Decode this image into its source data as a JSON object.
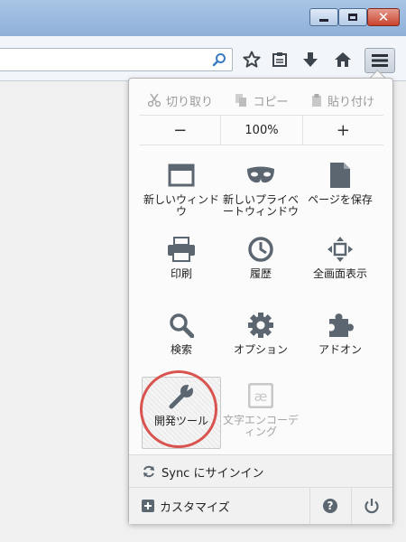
{
  "colors": {
    "titlebar": "#9fbde2",
    "panel_bg": "#fbfbfb",
    "icon_gray": "#5c6670",
    "highlight_circle": "#d9534f"
  },
  "window_controls": {
    "minimize_icon": "minimize-icon",
    "maximize_icon": "maximize-icon",
    "close_icon": "close-icon",
    "close_glyph": "✕"
  },
  "toolbar": {
    "icons": [
      "search-icon",
      "bookmark-star-icon",
      "reading-list-icon",
      "download-icon",
      "home-icon",
      "hamburger-menu-icon"
    ]
  },
  "menu": {
    "edit": {
      "cut": "切り取り",
      "copy": "コピー",
      "paste": "貼り付け"
    },
    "zoom": {
      "minus": "−",
      "level": "100%",
      "plus": "+"
    },
    "items": [
      {
        "label": "新しいウィンドウ",
        "icon": "new-window-icon",
        "enabled": true
      },
      {
        "label": "新しいプライベートウィンドウ",
        "icon": "private-window-icon",
        "enabled": true
      },
      {
        "label": "ページを保存",
        "icon": "save-page-icon",
        "enabled": true
      },
      {
        "label": "印刷",
        "icon": "print-icon",
        "enabled": true
      },
      {
        "label": "履歴",
        "icon": "history-icon",
        "enabled": true
      },
      {
        "label": "全画面表示",
        "icon": "fullscreen-icon",
        "enabled": true
      },
      {
        "label": "検索",
        "icon": "search-icon",
        "enabled": true
      },
      {
        "label": "オプション",
        "icon": "options-gear-icon",
        "enabled": true
      },
      {
        "label": "アドオン",
        "icon": "addons-puzzle-icon",
        "enabled": true
      },
      {
        "label": "開発ツール",
        "icon": "developer-wrench-icon",
        "enabled": true,
        "highlighted": true
      },
      {
        "label": "文字エンコーディング",
        "icon": "character-encoding-icon",
        "enabled": false
      }
    ],
    "sync": {
      "label": "Sync にサインイン",
      "icon": "sync-icon"
    },
    "customize": {
      "label": "カスタマイズ",
      "icon": "customize-plus-icon"
    },
    "help_icon": "help-icon",
    "quit_icon": "power-icon"
  }
}
